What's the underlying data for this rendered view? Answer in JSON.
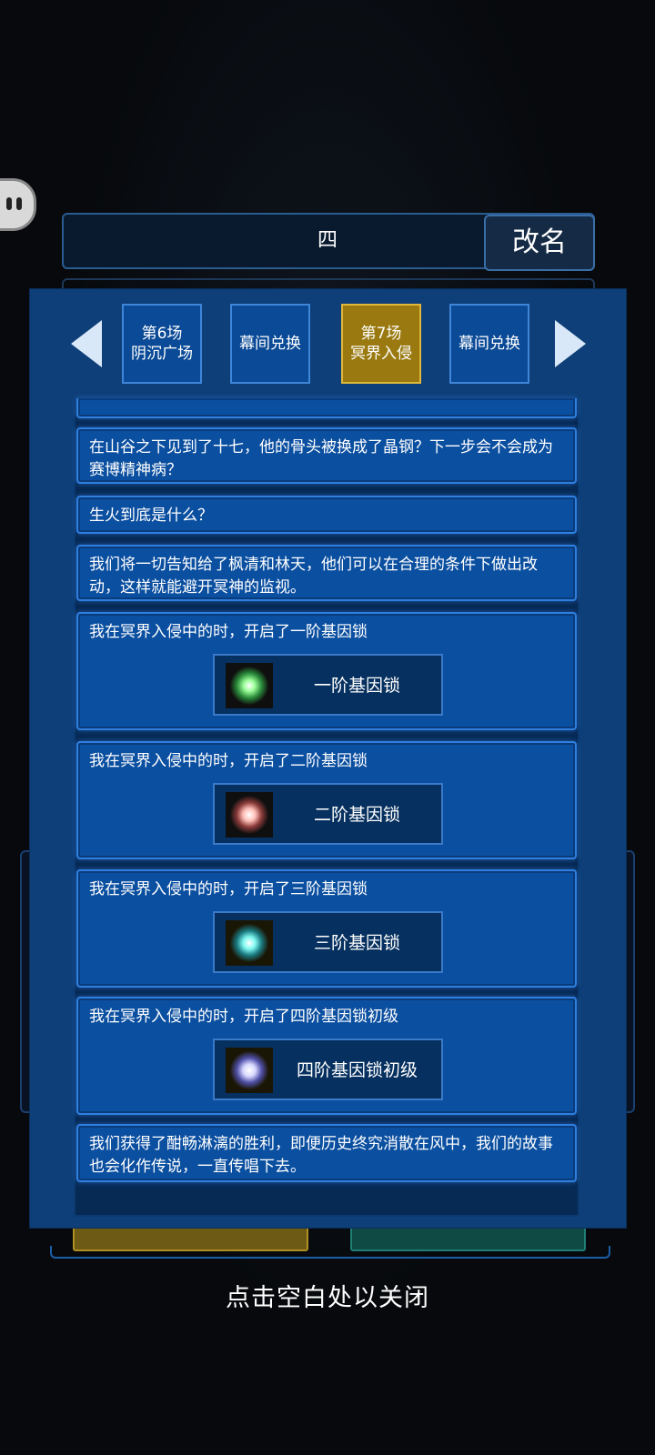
{
  "name_bar": {
    "name": "四",
    "rename_label": "改名"
  },
  "tabs": [
    {
      "label": "第6场\n阴沉广场",
      "active": false
    },
    {
      "label": "幕间兑换",
      "active": false
    },
    {
      "label": "第7场\n冥界入侵",
      "active": true
    },
    {
      "label": "幕间兑换",
      "active": false
    }
  ],
  "entries": [
    {
      "text": "在山谷之下见到了十七，他的骨头被换成了晶钢？下一步会不会成为赛博精神病？"
    },
    {
      "text": "生火到底是什么？"
    },
    {
      "text": "我们将一切告知给了枫清和林天，他们可以在合理的条件下做出改动，这样就能避开冥神的监视。"
    },
    {
      "text": "我在冥界入侵中的时，开启了一阶基因锁",
      "reward": "一阶基因锁",
      "reward_icon": "green-star-icon",
      "glow": "#7dff8a"
    },
    {
      "text": "我在冥界入侵中的时，开启了二阶基因锁",
      "reward": "二阶基因锁",
      "reward_icon": "pink-star-icon",
      "glow": "#ffb0a8"
    },
    {
      "text": "我在冥界入侵中的时，开启了三阶基因锁",
      "reward": "三阶基因锁",
      "reward_icon": "cyan-star-icon",
      "glow": "#5ff0e8"
    },
    {
      "text": "我在冥界入侵中的时，开启了四阶基因锁初级",
      "reward": "四阶基因锁初级",
      "reward_icon": "violet-star-icon",
      "glow": "#c8c8ff"
    },
    {
      "text": "我们获得了酣畅淋漓的胜利，即便历史终究消散在风中，我们的故事也会化作传说，一直传唱下去。"
    }
  ],
  "close_hint": "点击空白处以关闭"
}
